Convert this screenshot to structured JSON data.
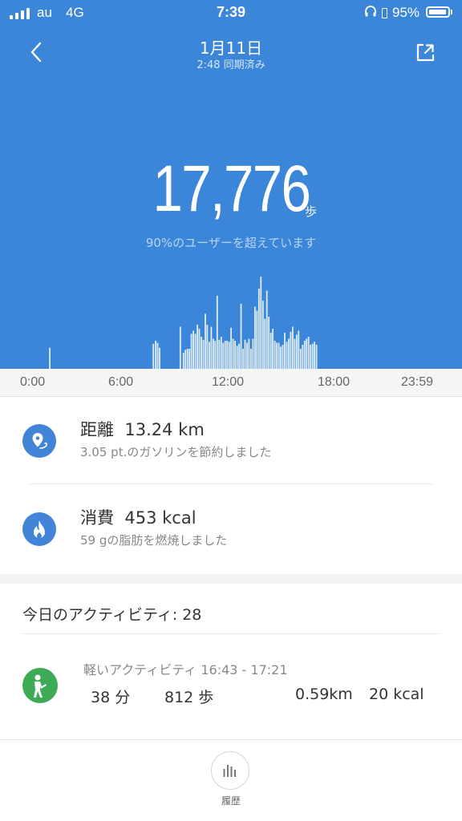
{
  "status_bar": {
    "carrier": "au",
    "network": "4G",
    "time": "7:39",
    "battery_percent": "95%",
    "battery_level": 0.95
  },
  "nav": {
    "title": "1月11日",
    "subtitle": "2:48 同期済み",
    "back_icon": "chevron-left-icon",
    "share_icon": "share-icon"
  },
  "summary": {
    "steps": "17,776",
    "steps_unit": "歩",
    "caption": "90%のユーザーを超えています"
  },
  "chart_data": {
    "type": "bar",
    "x_unit": "minutes of day",
    "x_range": [
      0,
      1439
    ],
    "ylim": [
      0,
      1
    ],
    "color": "#ffffff",
    "x": [
      60,
      425,
      433,
      440,
      447,
      520,
      531,
      538,
      545,
      552,
      559,
      566,
      573,
      580,
      587,
      594,
      601,
      608,
      615,
      622,
      629,
      636,
      643,
      650,
      657,
      664,
      671,
      678,
      685,
      692,
      699,
      706,
      713,
      720,
      727,
      734,
      741,
      748,
      755,
      762,
      769,
      776,
      783,
      790,
      797,
      804,
      811,
      818,
      825,
      832,
      839,
      846,
      853,
      860,
      867,
      874,
      881,
      888,
      895,
      902,
      909,
      916,
      923,
      930,
      937,
      944,
      951,
      958,
      965,
      972,
      979,
      986,
      993,
      1000
    ],
    "values": [
      0.21,
      0.25,
      0.28,
      0.26,
      0.21,
      0.42,
      0.16,
      0.19,
      0.2,
      0.2,
      0.35,
      0.38,
      0.35,
      0.44,
      0.4,
      0.32,
      0.29,
      0.55,
      0.44,
      0.27,
      0.42,
      0.3,
      0.28,
      0.73,
      0.29,
      0.32,
      0.26,
      0.28,
      0.28,
      0.27,
      0.41,
      0.3,
      0.28,
      0.23,
      0.25,
      0.65,
      0.2,
      0.29,
      0.26,
      0.3,
      0.2,
      0.3,
      0.62,
      0.58,
      0.8,
      0.92,
      0.68,
      0.5,
      0.78,
      0.52,
      0.36,
      0.4,
      0.28,
      0.26,
      0.26,
      0.22,
      0.24,
      0.36,
      0.27,
      0.3,
      0.37,
      0.42,
      0.3,
      0.34,
      0.38,
      0.2,
      0.24,
      0.28,
      0.3,
      0.32,
      0.24,
      0.25,
      0.27,
      0.24
    ],
    "tick_labels": [
      "0:00",
      "6:00",
      "12:00",
      "18:00",
      "23:59"
    ]
  },
  "stats": [
    {
      "icon": "location-pin-icon",
      "label": "距離",
      "value": "13.24 km",
      "sub": "3.05 pt.のガソリンを節約しました"
    },
    {
      "icon": "flame-icon",
      "label": "消費",
      "value": "453 kcal",
      "sub": "59 gの脂肪を燃焼しました"
    }
  ],
  "activity": {
    "header": "今日のアクティビティ: 28",
    "item": {
      "icon": "walking-person-icon",
      "title": "軽いアクティビティ 16:43 - 17:21",
      "duration": "38 分",
      "steps": "812 歩",
      "distance": "0.59km",
      "calories": "20 kcal"
    }
  },
  "bottom": {
    "history_label": "履歴",
    "history_icon": "bar-chart-icon"
  },
  "colors": {
    "primary": "#3b86d8",
    "icon_blue": "#4285d8",
    "icon_green": "#3daa55"
  }
}
